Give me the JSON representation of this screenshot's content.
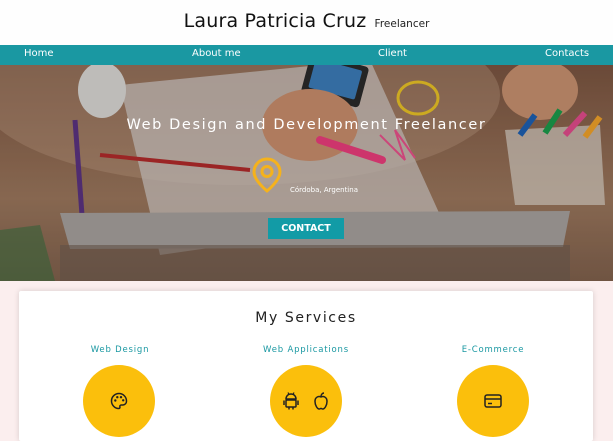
{
  "header": {
    "name": "Laura Patricia Cruz",
    "subtitle": "Freelancer"
  },
  "nav": {
    "items": [
      "Home",
      "About me",
      "Client",
      "Contacts"
    ]
  },
  "hero": {
    "title": "Web Design and Development Freelancer",
    "location": "Córdoba, Argentina",
    "contact_label": "CONTACT"
  },
  "services": {
    "title": "My Services",
    "items": [
      {
        "label": "Web Design",
        "icons": [
          "palette-icon"
        ]
      },
      {
        "label": "Web Applications",
        "icons": [
          "android-icon",
          "apple-icon"
        ]
      },
      {
        "label": "E-Commerce",
        "icons": [
          "credit-card-icon"
        ]
      }
    ]
  },
  "colors": {
    "teal": "#1a98a2",
    "yellow": "#fbbf0c",
    "pin": "#f5b21c"
  }
}
